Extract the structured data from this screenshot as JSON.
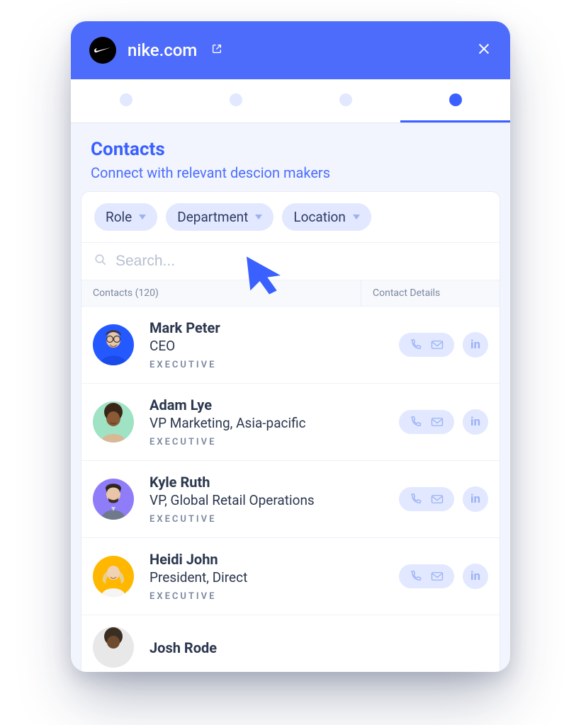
{
  "header": {
    "domain": "nike.com"
  },
  "tabs": [
    {
      "active": false
    },
    {
      "active": false
    },
    {
      "active": false
    },
    {
      "active": true
    }
  ],
  "page": {
    "title": "Contacts",
    "subtitle": "Connect with relevant descion makers"
  },
  "filters": [
    {
      "label": "Role"
    },
    {
      "label": "Department"
    },
    {
      "label": "Location"
    }
  ],
  "search": {
    "placeholder": "Search..."
  },
  "columns": {
    "left": "Contacts (120)",
    "right": "Contact Details"
  },
  "contacts": [
    {
      "name": "Mark Peter",
      "title": "CEO",
      "tag": "EXECUTIVE"
    },
    {
      "name": "Adam Lye",
      "title": "VP Marketing, Asia-pacific",
      "tag": "EXECUTIVE"
    },
    {
      "name": "Kyle Ruth",
      "title": "VP, Global Retail Operations",
      "tag": "EXECUTIVE"
    },
    {
      "name": "Heidi John",
      "title": "President, Direct",
      "tag": "EXECUTIVE"
    },
    {
      "name": "Josh Rode",
      "title": "",
      "tag": ""
    }
  ]
}
